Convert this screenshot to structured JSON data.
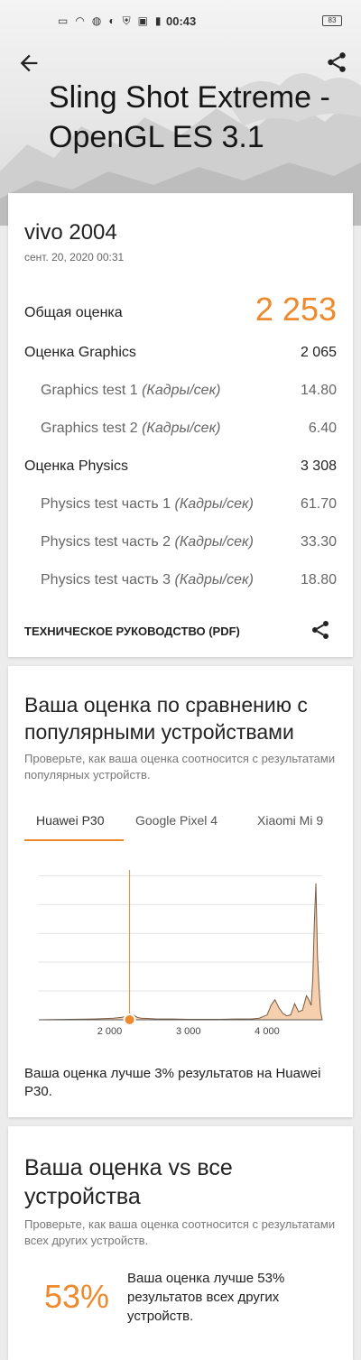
{
  "status_bar": {
    "time": "00:43",
    "battery": "83"
  },
  "header": {
    "title": "Sling Shot Extreme - OpenGL ES 3.1"
  },
  "result": {
    "device": "vivo 2004",
    "date": "сент. 20, 2020 00:31",
    "overall_label": "Общая оценка",
    "overall_value": "2 253",
    "graphics_label": "Оценка Graphics",
    "graphics_value": "2 065",
    "graphics_tests": [
      {
        "label": "Graphics test 1",
        "unit": "(Кадры/сек)",
        "value": "14.80"
      },
      {
        "label": "Graphics test 2",
        "unit": "(Кадры/сек)",
        "value": "6.40"
      }
    ],
    "physics_label": "Оценка Physics",
    "physics_value": "3 308",
    "physics_tests": [
      {
        "label": "Physics test часть 1",
        "unit": "(Кадры/сек)",
        "value": "61.70"
      },
      {
        "label": "Physics test часть 2",
        "unit": "(Кадры/сек)",
        "value": "33.30"
      },
      {
        "label": "Physics test часть 3",
        "unit": "(Кадры/сек)",
        "value": "18.80"
      }
    ],
    "pdf_link": "ТЕХНИЧЕСКОЕ РУКОВОДСТВО (PDF)"
  },
  "comparison": {
    "heading": "Ваша оценка по сравнению с популярными устройствами",
    "subtitle": "Проверьте, как ваша оценка соотносится с результатами популярных устройств.",
    "tabs": [
      "Huawei P30",
      "Google Pixel 4",
      "Xiaomi Mi 9"
    ],
    "active_tab": 0,
    "result_text": "Ваша оценка лучше 3% результатов на Huawei P30."
  },
  "all_devices": {
    "heading": "Ваша оценка vs все устройства",
    "subtitle": "Проверьте, как ваша оценка соотносится с результатами всех других устройств.",
    "percent": "53%",
    "percent_text": "Ваша оценка лучше 53% результатов всех других устройств."
  },
  "colors": {
    "accent": "#ee8a2d",
    "hist_fill": "#f6cfae"
  },
  "chart_data": {
    "type": "area",
    "xlabel": "",
    "ylabel": "",
    "xlim": [
      1100,
      4700
    ],
    "x_ticks": [
      "2 000",
      "3 000",
      "4 000"
    ],
    "tick_values": [
      2000,
      3000,
      4000
    ],
    "marker_value": 2253,
    "series": [
      {
        "x": [
          1100,
          1500,
          1800,
          1950,
          2050,
          2150,
          2200,
          2253,
          2300,
          2350,
          2400,
          2500,
          2600,
          2800,
          3000,
          3200,
          3400,
          3600,
          3800,
          3900,
          4000,
          4050,
          4100,
          4150,
          4200,
          4250,
          4300,
          4350,
          4400,
          4450,
          4500,
          4530,
          4560,
          4580,
          4600,
          4620,
          4640,
          4660,
          4680,
          4700
        ],
        "values": [
          0,
          0.5,
          1,
          1.5,
          2,
          3,
          4,
          8,
          6,
          3,
          2,
          1.5,
          1,
          1,
          0.5,
          0.5,
          0.5,
          1,
          1,
          2,
          6,
          18,
          25,
          15,
          8,
          5,
          6,
          20,
          10,
          12,
          30,
          25,
          18,
          50,
          120,
          170,
          80,
          40,
          10,
          0
        ]
      }
    ],
    "ylim": [
      0,
      180
    ]
  }
}
